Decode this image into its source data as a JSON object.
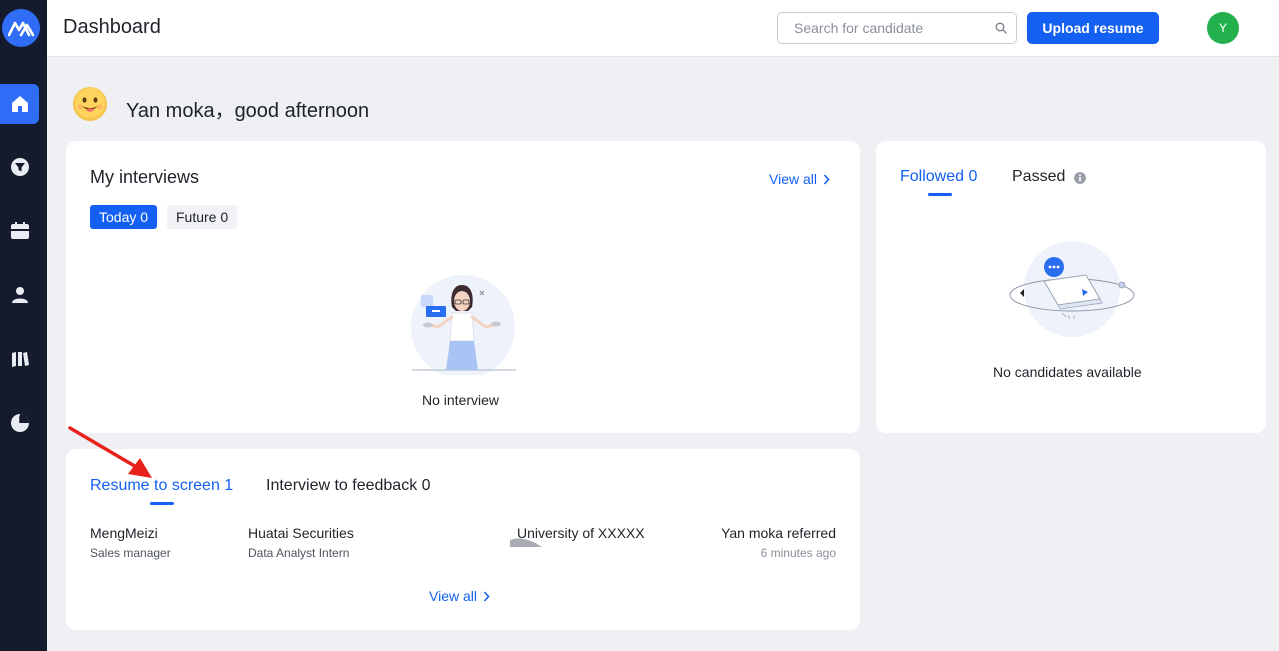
{
  "header": {
    "title": "Dashboard",
    "search_placeholder": "Search for candidate",
    "upload_label": "Upload resume",
    "avatar_initial": "Y"
  },
  "sidebar": {
    "items": [
      {
        "icon": "home-icon",
        "active": true
      },
      {
        "icon": "funnel-icon",
        "active": false
      },
      {
        "icon": "calendar-icon",
        "active": false
      },
      {
        "icon": "user-icon",
        "active": false
      },
      {
        "icon": "book-icon",
        "active": false
      },
      {
        "icon": "pie-chart-icon",
        "active": false
      }
    ]
  },
  "greeting": {
    "text": "Yan moka，good afternoon"
  },
  "interviews": {
    "title": "My interviews",
    "view_all": "View all",
    "tabs": [
      {
        "label": "Today 0",
        "active": true
      },
      {
        "label": "Future 0",
        "active": false
      }
    ],
    "empty_text": "No interview"
  },
  "followed": {
    "tabs": [
      {
        "label": "Followed 0",
        "active": true
      },
      {
        "label": "Passed",
        "active": false
      }
    ],
    "empty_text": "No candidates available"
  },
  "resume": {
    "tabs": [
      {
        "label": "Resume to screen 1",
        "active": true
      },
      {
        "label": "Interview to feedback 0",
        "active": false
      }
    ],
    "row": {
      "name": "MengMeizi",
      "position": "Sales manager",
      "company": "Huatai Securities",
      "job": "Data Analyst Intern",
      "school": "University of XXXXX",
      "referral": "Yan moka referred",
      "time": "6 minutes ago"
    },
    "view_all": "View all"
  },
  "colors": {
    "accent": "#1360f2",
    "sidebar_bg": "#141b2d",
    "page_bg": "#eef0f4",
    "avatar_bg": "#23b14d",
    "annotation_arrow": "#e8221b"
  }
}
